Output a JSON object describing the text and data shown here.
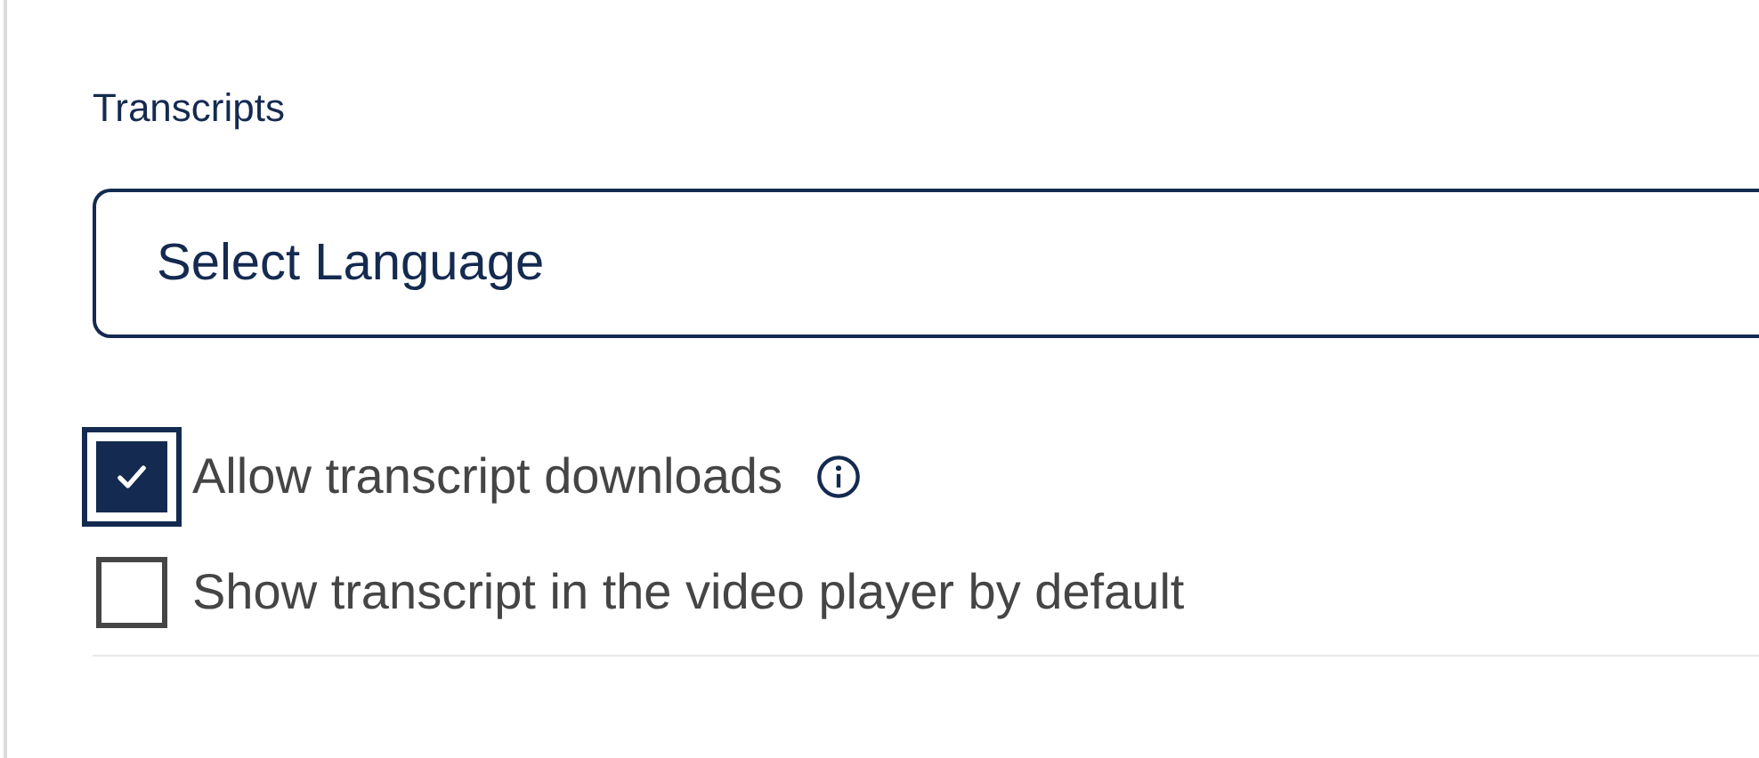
{
  "section": {
    "title": "Transcripts"
  },
  "language_select": {
    "value": "Select Language"
  },
  "options": [
    {
      "label": "Allow transcript downloads",
      "checked": true,
      "focused": true,
      "info": true
    },
    {
      "label": "Show transcript in the video player by default",
      "checked": false,
      "focused": false,
      "info": false
    }
  ]
}
